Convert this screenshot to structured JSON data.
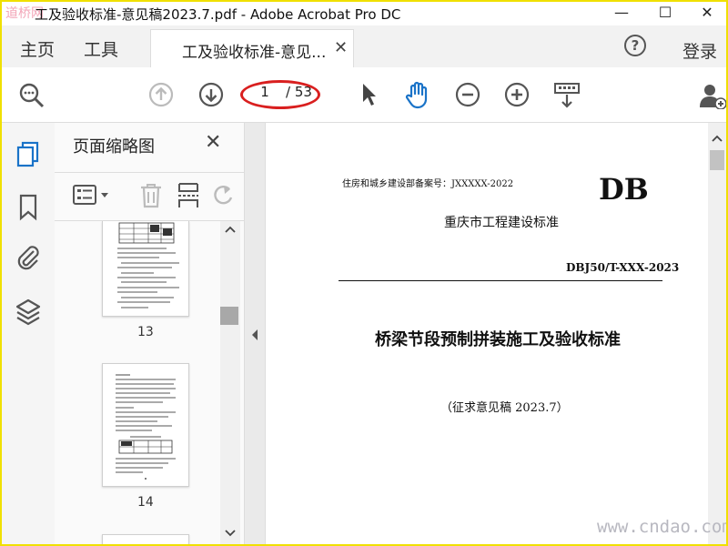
{
  "window": {
    "title": "工及验收标准-意见稿2023.7.pdf - Adobe Acrobat Pro DC",
    "watermark_logo": "道桥网",
    "controls": [
      "—",
      "☐",
      "✕"
    ]
  },
  "tabs": {
    "home": "主页",
    "tools": "工具",
    "document": "工及验收标准-意见...",
    "close": "✕",
    "help": "?",
    "login": "登录"
  },
  "toolbar": {
    "current_page": "1",
    "total_pages": "/ 53",
    "icons": [
      "search-zoom-icon",
      "prev-page-icon",
      "next-page-icon",
      "select-cursor-icon",
      "hand-tool-icon",
      "zoom-out-icon",
      "zoom-in-icon",
      "keyboard-scroll-icon",
      "add-user-icon"
    ]
  },
  "sidebar": {
    "panel_title": "页面缩略图",
    "close": "✕",
    "thumbnails": [
      {
        "label": "13"
      },
      {
        "label": "14"
      }
    ]
  },
  "document": {
    "record_no": "住房和城乡建设部备案号：JXXXXX-2022",
    "db": "DB",
    "org": "重庆市工程建设标准",
    "code": "DBJ50/T-XXX-2023",
    "title": "桥梁节段预制拼装施工及验收标准",
    "draft": "（征求意见稿 2023.7）"
  },
  "footer_watermark": "www.cndao.com",
  "colors": {
    "accent_blue": "#1a73c8",
    "highlight_red": "#d91f1f",
    "border_yellow": "#f0e000"
  }
}
